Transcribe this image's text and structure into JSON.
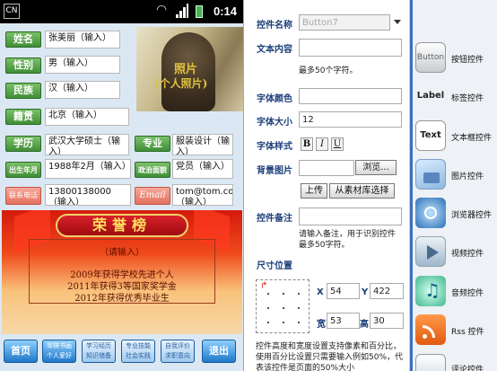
{
  "status_bar": {
    "carrier_icon_text": "CN",
    "time": "0:14"
  },
  "form": {
    "rows": [
      {
        "label": "姓名",
        "value": "张美丽（输入）"
      },
      {
        "label": "性别",
        "value": "男（输入）"
      },
      {
        "label": "民族",
        "value": "汉（输入）"
      },
      {
        "label": "籍贯",
        "value": "北京（输入）"
      }
    ],
    "education": {
      "label": "学历",
      "value": "武汉大学硕士（输入）"
    },
    "major": {
      "label": "专业",
      "value": "服装设计（输入）"
    },
    "birth": {
      "label": "出生年月",
      "value": "1988年2月（输入）"
    },
    "political": {
      "label": "政治面貌",
      "value": "党员（输入）"
    },
    "phone": {
      "label": "联系电话",
      "value": "13800138000（输入）"
    },
    "email": {
      "label": "Email",
      "value": "tom@tom.com（输入）"
    }
  },
  "portrait": {
    "caption_line1": "照片",
    "caption_line2": "(个人照片)"
  },
  "honor": {
    "title": "荣誉榜",
    "note": "（请输入）",
    "lines": [
      "2009年获得学校先进个人",
      "2011年获得3等国家奖学金",
      "2012年获得优秀毕业生"
    ]
  },
  "bottom_bar": {
    "home": "首页",
    "b2": "琴棋书画 个人爱好",
    "b3": "学习经历 知识储备",
    "b4": "专业技能 社会实践",
    "b5": "自我评价 求职意向",
    "exit": "退出"
  },
  "properties": {
    "name_label": "控件名称",
    "name_value": "Button7",
    "content_label": "文本内容",
    "content_hint": "最多50个字符。",
    "font_color_label": "字体颜色",
    "font_size_label": "字体大小",
    "font_size_value": "12",
    "font_style_label": "字体样式",
    "style_bold": "B",
    "style_italic": "I",
    "style_underline": "U",
    "bg_label": "背景图片",
    "browse_label": "浏览...",
    "upload_label": "上传",
    "library_label": "从素材库选择",
    "remark_label": "控件备注",
    "remark_hint": "请输入备注，用于识别控件 最多50字符。",
    "size_pos_label": "尺寸位置",
    "x_label": "X",
    "x_value": "54",
    "y_label": "Y",
    "y_value": "422",
    "w_label": "宽",
    "w_value": "53",
    "h_label": "高",
    "h_value": "30",
    "footer_note": "控件高度和宽度设置支持像素和百分比，使用百分比设置只需要输入例如50%，代表该控件是页面的50%大小"
  },
  "palette": {
    "items": [
      {
        "icon_text": "Button",
        "label": "按钮控件"
      },
      {
        "icon_text": "Label",
        "label": "标签控件"
      },
      {
        "icon_text": "Text",
        "label": "文本框控件"
      },
      {
        "icon_text": "",
        "label": "图片控件"
      },
      {
        "icon_text": "",
        "label": "浏览器控件"
      },
      {
        "icon_text": "",
        "label": "视频控件"
      },
      {
        "icon_text": "",
        "label": "音频控件"
      },
      {
        "icon_text": "",
        "label": "Rss 控件"
      },
      {
        "icon_text": "",
        "label": "评论控件"
      }
    ]
  },
  "colors": {
    "label_green": "#4a9a3e",
    "label_orange": "#ea7c6a",
    "nav_blue": "#1f78c8",
    "section_heading": "#1c3f7a"
  }
}
